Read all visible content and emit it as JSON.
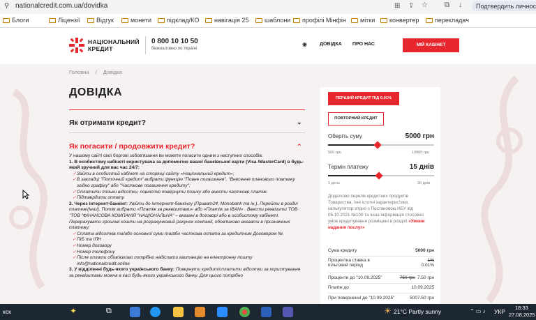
{
  "browser": {
    "url": "nationalcredit.com.ua/dovidka",
    "profile_label": "Подтвердить личность",
    "bookmarks": [
      "Блоги",
      "Ліцензії",
      "Відгук",
      "монети",
      "підклад/КО",
      "навігація 25",
      "шаблони",
      "профілі Мінфін",
      "мітки",
      "конвертер",
      "перекладач"
    ]
  },
  "header": {
    "logo_line1": "НАЦІОНАЛЬНИЙ",
    "logo_line2": "КРЕДИТ",
    "phone": "0 800 10 10 50",
    "phone_note": "безкоштовно по Україні",
    "nav": [
      "ДОВІДКА",
      "ПРО НАС"
    ],
    "cabinet": "МІЙ КАБІНЕТ"
  },
  "breadcrumb": {
    "home": "Головна",
    "sep": "/",
    "current": "Довідка"
  },
  "page_title": "ДОВІДКА",
  "faq": [
    {
      "question": "Як отримати кредит?",
      "icon": "chevron-down"
    },
    {
      "question": "Як погасити / продовжити кредит?",
      "icon": "chevron-up"
    }
  ],
  "answer": {
    "intro": "У нашому сайті свої боргові зобов'язання ви можете погасити одним з наступних способів:",
    "s1_title": "1. В особистому кабінеті користувача за допомогою вашої банківської карти (Visa /MasterCard) в будь-який зручний для вас час 24/7:",
    "s1_items": [
      "Зайти в особистий кабінет на сторінці сайту «Національний кредит»;",
      "В закладці \"Поточний кредит\" вибрати функцію \"Повне погашення\", \"Внесення планового платежу згідно графіку\" або \"Часткове погашення кредиту\";",
      "Оплатити тільки відсотки, повністю повернути позику або внести часткове платіж.",
      "Підтвердити оплату."
    ],
    "s2_title": "2. Через інтернет-банкінг: ",
    "s2_text": "Увійти до інтернет-банкінгу (Приват24, Monobank та ін.). Перейти в розділ платежі(Інші). Потім вибрати «Платіж за реквізитами» або «Платіж за IBAN» . Ввести реквізити ТОВ \"ТОВ \"ФІНАНСОВА КОМПАНІЯ \"НАЦІОНАЛЬНА\" – вказані в договорі або в особистому кабінеті. Перерахувати грошові кошти на розрахунковий рахунок компанії, обов'язково вказати в призначенні платежу:",
    "s2_items": [
      "Сплата відсотків та/або основної суми та/або часткова оплата за кредитним Договором №",
      "ПІБ та ІПН",
      "Номер договору",
      "Номер телефону",
      "Після оплати обов'язково потрібно надіслати квитанцію на електронну пошту info@nationalcredit.online"
    ],
    "s3_title": "3. У відділенні будь-якого українського банку: ",
    "s3_text": "Повернути кредит/сплатити відсотки за користування за реквізитами можна в касі будь-якого українського банку. Для цього потрібно"
  },
  "calculator": {
    "btn_first": "ПЕРШИЙ КРЕДИТ ПІД 0,01%",
    "btn_repeat": "ПОВТОРНИЙ КРЕДИТ",
    "sum_label": "Оберіть суму",
    "sum_value": "5000 грн",
    "sum_min": "500 грн",
    "sum_max": "10000 грн",
    "sum_fraction": 0.47,
    "term_label": "Термін платежу",
    "term_value": "15 днів",
    "term_min": "1 день",
    "term_max": "30 днів",
    "term_fraction": 0.48,
    "info_text": "Додатково перелік кредитних продуктів Товариства, їхні істотні характеристики, калькулятор згідно з Постановою НБУ від 05.10.2021 №100 та інша інформація стосовно умов кредитування розміщені в розділі ",
    "info_link": "«Умови надання послуг»",
    "rows": [
      {
        "label": "Сума кредиту",
        "value": "5000 грн"
      },
      {
        "label": "Процентна ставка в пільговий період",
        "old": "1%",
        "value": "0.01%"
      },
      {
        "label": "Проценти до \"10.09.2025\"",
        "old": "750 грн",
        "value": "7.50 грн"
      },
      {
        "label": "Платіж до",
        "value": "10.09.2025"
      },
      {
        "label": "При поверненні до \"10.09.2025\"",
        "value": "5007.50 грн"
      }
    ],
    "accent": "#e8262d"
  },
  "taskbar": {
    "left_text": "кск",
    "weather": "21°C  Partly sunny",
    "lang": "УКР",
    "time": "18:33",
    "date": "27.08.2025"
  }
}
